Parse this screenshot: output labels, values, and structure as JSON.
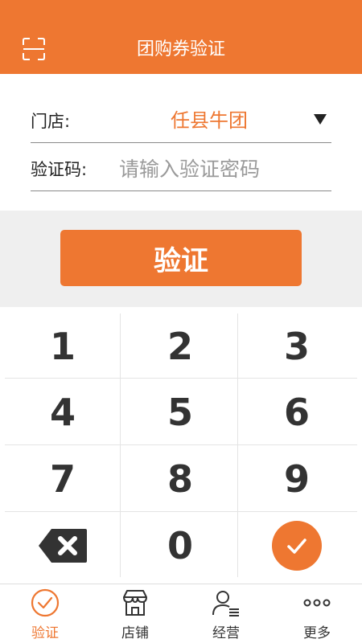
{
  "header": {
    "title": "团购券验证",
    "scan_icon": "scan-frame-icon"
  },
  "form": {
    "store_label": "门店:",
    "store_value": "任县牛团",
    "code_label": "验证码:",
    "code_placeholder": "请输入验证密码",
    "code_value": ""
  },
  "verify_button": {
    "label": "验证"
  },
  "keypad": {
    "keys": [
      "1",
      "2",
      "3",
      "4",
      "5",
      "6",
      "7",
      "8",
      "9",
      "",
      "0",
      ""
    ],
    "special": {
      "backspace_icon": "backspace-icon",
      "confirm_icon": "check-icon"
    }
  },
  "tabbar": {
    "active_index": 0,
    "tabs": [
      {
        "label": "验证",
        "icon": "check-circle-icon"
      },
      {
        "label": "店铺",
        "icon": "store-icon"
      },
      {
        "label": "经营",
        "icon": "user-list-icon"
      },
      {
        "label": "更多",
        "icon": "more-dots-icon"
      }
    ]
  },
  "colors": {
    "accent": "#ee7731",
    "background_gray": "#efefef",
    "key_text": "#333333"
  }
}
